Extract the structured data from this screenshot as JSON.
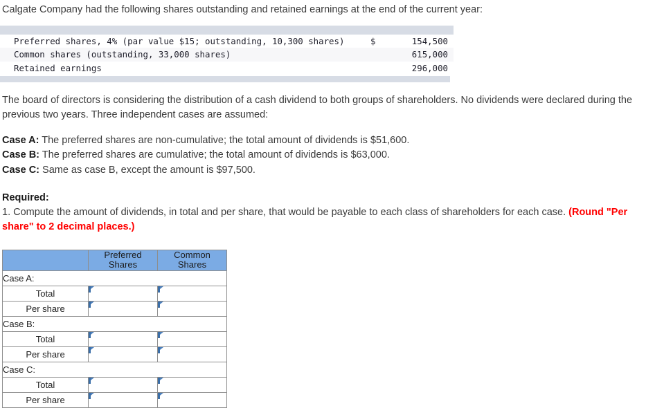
{
  "intro": "Calgate Company had the following shares outstanding and retained earnings at the end of the current year:",
  "financials": {
    "rows": [
      {
        "label": "Preferred shares, 4% (par value $15; outstanding, 10,300 shares)",
        "currency": "$",
        "amount": "154,500"
      },
      {
        "label": "Common shares (outstanding, 33,000 shares)",
        "currency": "",
        "amount": "615,000"
      },
      {
        "label": "Retained earnings",
        "currency": "",
        "amount": "296,000"
      }
    ]
  },
  "paragraph": "The board of directors is considering the distribution of a cash dividend to both groups of shareholders. No dividends were declared during the previous two years. Three independent cases are assumed:",
  "cases": [
    {
      "label": "Case A:",
      "text": " The preferred shares are non-cumulative; the total amount of dividends is $51,600."
    },
    {
      "label": "Case B:",
      "text": " The preferred shares are cumulative; the total amount of dividends is $63,000."
    },
    {
      "label": "Case C:",
      "text": " Same as case B, except the amount is $97,500."
    }
  ],
  "required": {
    "heading": "Required:",
    "item": "1. Compute the amount of dividends, in total and per share, that would be payable to each class of shareholders for each case. ",
    "note_red": "(Round \"Per share\" to 2 decimal places.)"
  },
  "answer_table": {
    "headers": {
      "blank": "",
      "preferred": "Preferred\nShares",
      "preferred_line1": "Preferred",
      "preferred_line2": "Shares",
      "common_line1": "Common",
      "common_line2": "Shares"
    },
    "rows": [
      {
        "type": "case",
        "label": "Case A:"
      },
      {
        "type": "input",
        "label": "Total",
        "preferred": "",
        "common": ""
      },
      {
        "type": "input",
        "label": "Per share",
        "preferred": "",
        "common": ""
      },
      {
        "type": "case",
        "label": "Case B:"
      },
      {
        "type": "input",
        "label": "Total",
        "preferred": "",
        "common": ""
      },
      {
        "type": "input",
        "label": "Per share",
        "preferred": "",
        "common": ""
      },
      {
        "type": "case",
        "label": "Case C:"
      },
      {
        "type": "input",
        "label": "Total",
        "preferred": "",
        "common": ""
      },
      {
        "type": "input",
        "label": "Per share",
        "preferred": "",
        "common": ""
      }
    ]
  },
  "colors": {
    "header_blue": "#7babe4",
    "input_border_blue": "#4a7ebb",
    "band_gray": "#d7dce5",
    "alert_red": "#ff0000"
  }
}
